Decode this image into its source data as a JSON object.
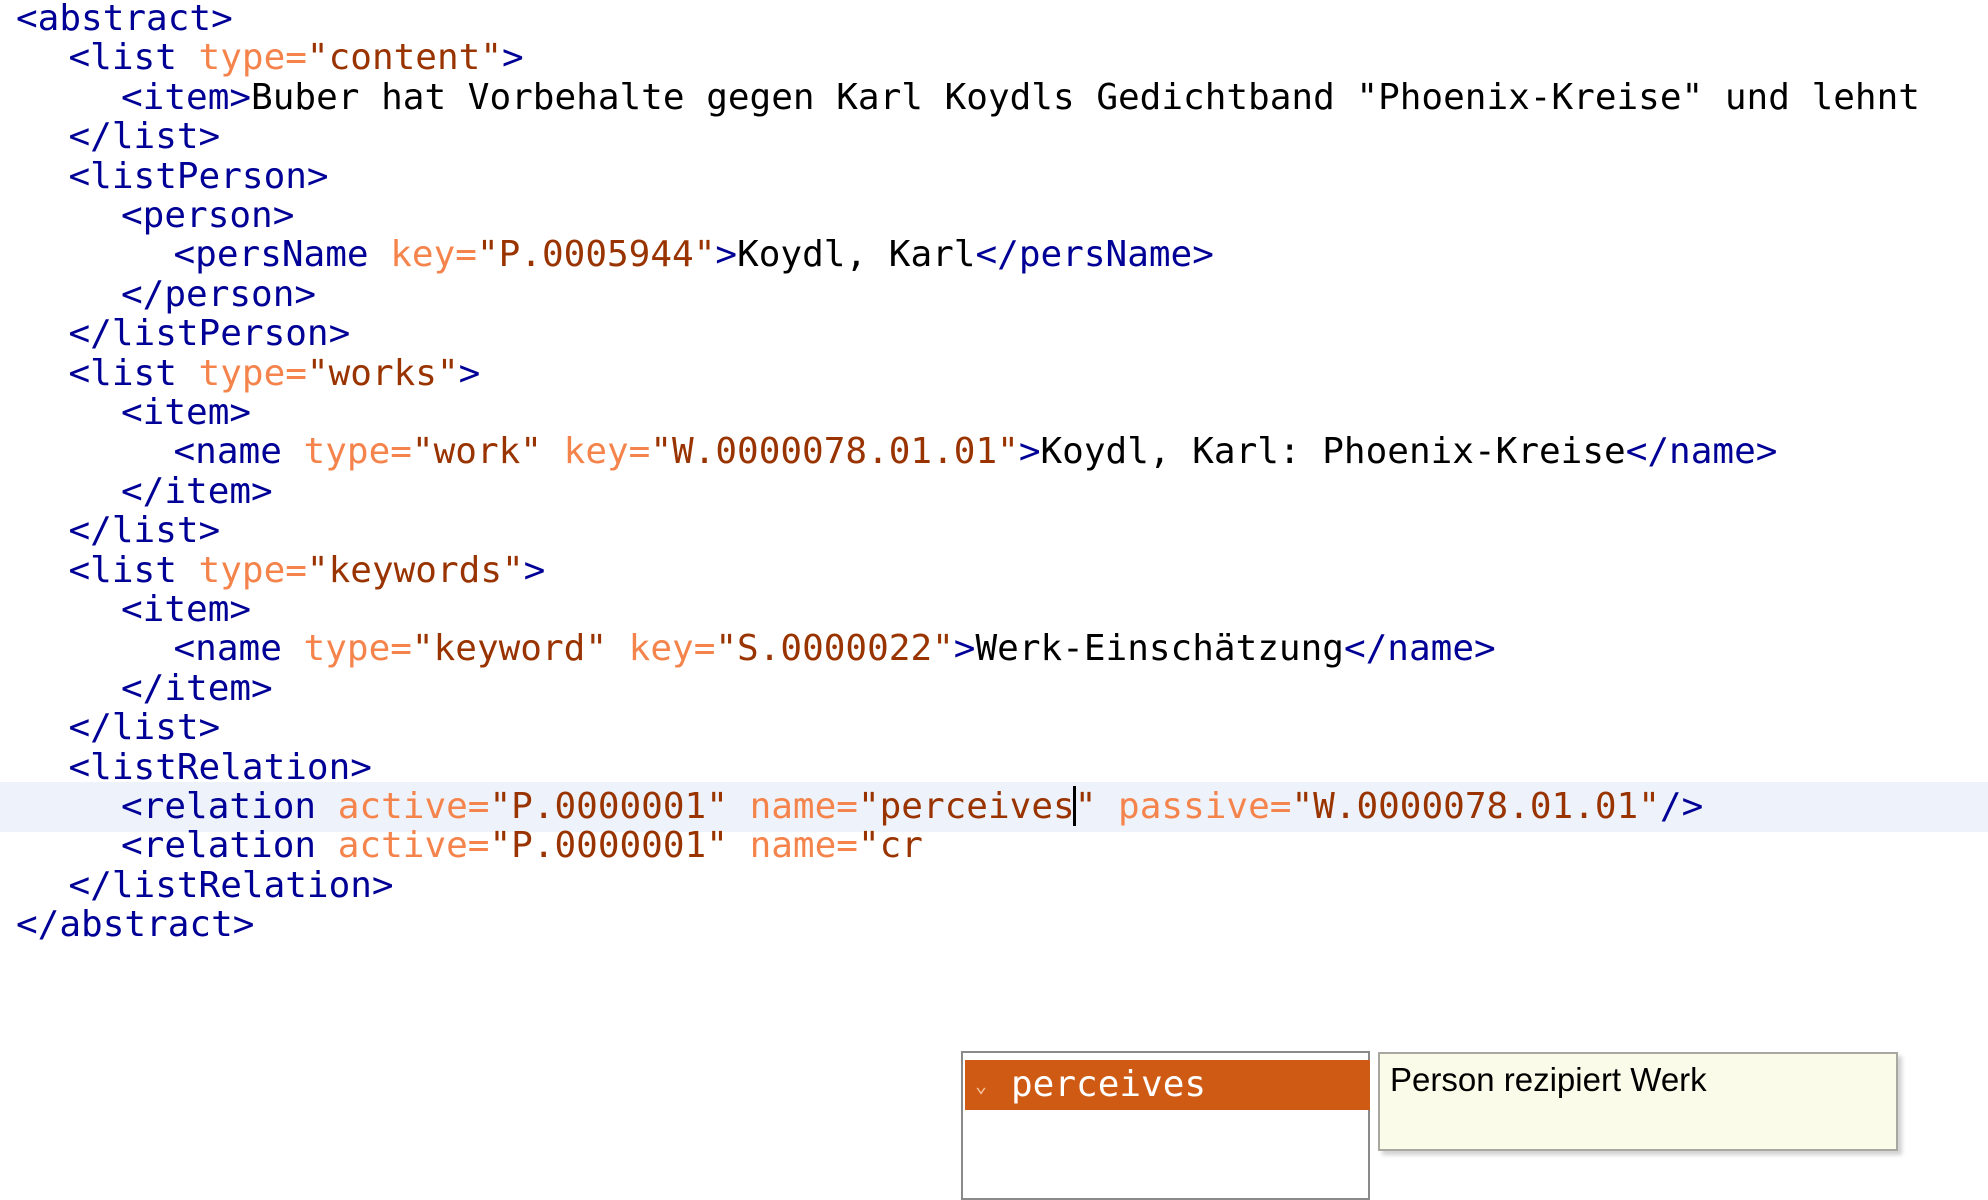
{
  "editor": {
    "lines": [
      {
        "indent": 0,
        "tokens": [
          {
            "t": "tag",
            "v": "<abstract>"
          }
        ]
      },
      {
        "indent": 1,
        "tokens": [
          {
            "t": "tag",
            "v": "<list "
          },
          {
            "t": "attr",
            "v": "type="
          },
          {
            "t": "val",
            "v": "\"content\""
          },
          {
            "t": "tag",
            "v": ">"
          }
        ]
      },
      {
        "indent": 2,
        "tokens": [
          {
            "t": "tag",
            "v": "<item>"
          },
          {
            "t": "txt",
            "v": "Buber hat Vorbehalte gegen Karl Koydls Gedichtband \"Phoenix-Kreise\" und lehnt"
          }
        ]
      },
      {
        "indent": 1,
        "tokens": [
          {
            "t": "tag",
            "v": "</list>"
          }
        ]
      },
      {
        "indent": 1,
        "tokens": [
          {
            "t": "tag",
            "v": "<listPerson>"
          }
        ]
      },
      {
        "indent": 2,
        "tokens": [
          {
            "t": "tag",
            "v": "<person>"
          }
        ]
      },
      {
        "indent": 3,
        "tokens": [
          {
            "t": "tag",
            "v": "<persName "
          },
          {
            "t": "attr",
            "v": "key="
          },
          {
            "t": "val",
            "v": "\"P.0005944\""
          },
          {
            "t": "tag",
            "v": ">"
          },
          {
            "t": "txt",
            "v": "Koydl, Karl"
          },
          {
            "t": "tag",
            "v": "</persName>"
          }
        ]
      },
      {
        "indent": 2,
        "tokens": [
          {
            "t": "tag",
            "v": "</person>"
          }
        ]
      },
      {
        "indent": 1,
        "tokens": [
          {
            "t": "tag",
            "v": "</listPerson>"
          }
        ]
      },
      {
        "indent": 1,
        "tokens": [
          {
            "t": "tag",
            "v": "<list "
          },
          {
            "t": "attr",
            "v": "type="
          },
          {
            "t": "val",
            "v": "\"works\""
          },
          {
            "t": "tag",
            "v": ">"
          }
        ]
      },
      {
        "indent": 2,
        "tokens": [
          {
            "t": "tag",
            "v": "<item>"
          }
        ]
      },
      {
        "indent": 3,
        "tokens": [
          {
            "t": "tag",
            "v": "<name "
          },
          {
            "t": "attr",
            "v": "type="
          },
          {
            "t": "val",
            "v": "\"work\" "
          },
          {
            "t": "attr",
            "v": "key="
          },
          {
            "t": "val",
            "v": "\"W.0000078.01.01\""
          },
          {
            "t": "tag",
            "v": ">"
          },
          {
            "t": "txt",
            "v": "Koydl, Karl: Phoenix-Kreise"
          },
          {
            "t": "tag",
            "v": "</name>"
          }
        ]
      },
      {
        "indent": 2,
        "tokens": [
          {
            "t": "tag",
            "v": "</item>"
          }
        ]
      },
      {
        "indent": 1,
        "tokens": [
          {
            "t": "tag",
            "v": "</list>"
          }
        ]
      },
      {
        "indent": 1,
        "tokens": [
          {
            "t": "tag",
            "v": "<list "
          },
          {
            "t": "attr",
            "v": "type="
          },
          {
            "t": "val",
            "v": "\"keywords\""
          },
          {
            "t": "tag",
            "v": ">"
          }
        ]
      },
      {
        "indent": 2,
        "tokens": [
          {
            "t": "tag",
            "v": "<item>"
          }
        ]
      },
      {
        "indent": 3,
        "tokens": [
          {
            "t": "tag",
            "v": "<name "
          },
          {
            "t": "attr",
            "v": "type="
          },
          {
            "t": "val",
            "v": "\"keyword\" "
          },
          {
            "t": "attr",
            "v": "key="
          },
          {
            "t": "val",
            "v": "\"S.0000022\""
          },
          {
            "t": "tag",
            "v": ">"
          },
          {
            "t": "txt",
            "v": "Werk-Einschätzung"
          },
          {
            "t": "tag",
            "v": "</name>"
          }
        ]
      },
      {
        "indent": 2,
        "tokens": [
          {
            "t": "tag",
            "v": "</item>"
          }
        ]
      },
      {
        "indent": 1,
        "tokens": [
          {
            "t": "tag",
            "v": "</list>"
          }
        ]
      },
      {
        "indent": 1,
        "tokens": [
          {
            "t": "tag",
            "v": "<listRelation>"
          }
        ]
      },
      {
        "indent": 2,
        "current": true,
        "tokens": [
          {
            "t": "tag",
            "v": "<relation "
          },
          {
            "t": "attr",
            "v": "active="
          },
          {
            "t": "val",
            "v": "\"P.0000001\" "
          },
          {
            "t": "attr",
            "v": "name="
          },
          {
            "t": "val",
            "v": "\"perceives"
          },
          {
            "t": "caret",
            "v": ""
          },
          {
            "t": "val",
            "v": "\" "
          },
          {
            "t": "attr",
            "v": "passive="
          },
          {
            "t": "val",
            "v": "\"W.0000078.01.01\""
          },
          {
            "t": "tag",
            "v": "/>"
          }
        ]
      },
      {
        "indent": 2,
        "tokens": [
          {
            "t": "tag",
            "v": "<relation "
          },
          {
            "t": "attr",
            "v": "active="
          },
          {
            "t": "val",
            "v": "\"P.0000001\" "
          },
          {
            "t": "attr",
            "v": "name="
          },
          {
            "t": "val",
            "v": "\"cr"
          }
        ]
      },
      {
        "indent": 1,
        "tokens": [
          {
            "t": "tag",
            "v": "</listRelation>"
          }
        ]
      },
      {
        "indent": 0,
        "tokens": [
          {
            "t": "tag",
            "v": "</abstract>"
          }
        ]
      }
    ]
  },
  "completion": {
    "selected_label": "perceives",
    "icon": "value-chevron-icon"
  },
  "tooltip": {
    "text": "Person rezipiert Werk"
  },
  "colors": {
    "tag": "#000096",
    "attribute": "#f5844c",
    "value": "#993300",
    "text": "#000000",
    "selection": "#cf5a13",
    "tooltip_bg": "#fbfbe9"
  }
}
